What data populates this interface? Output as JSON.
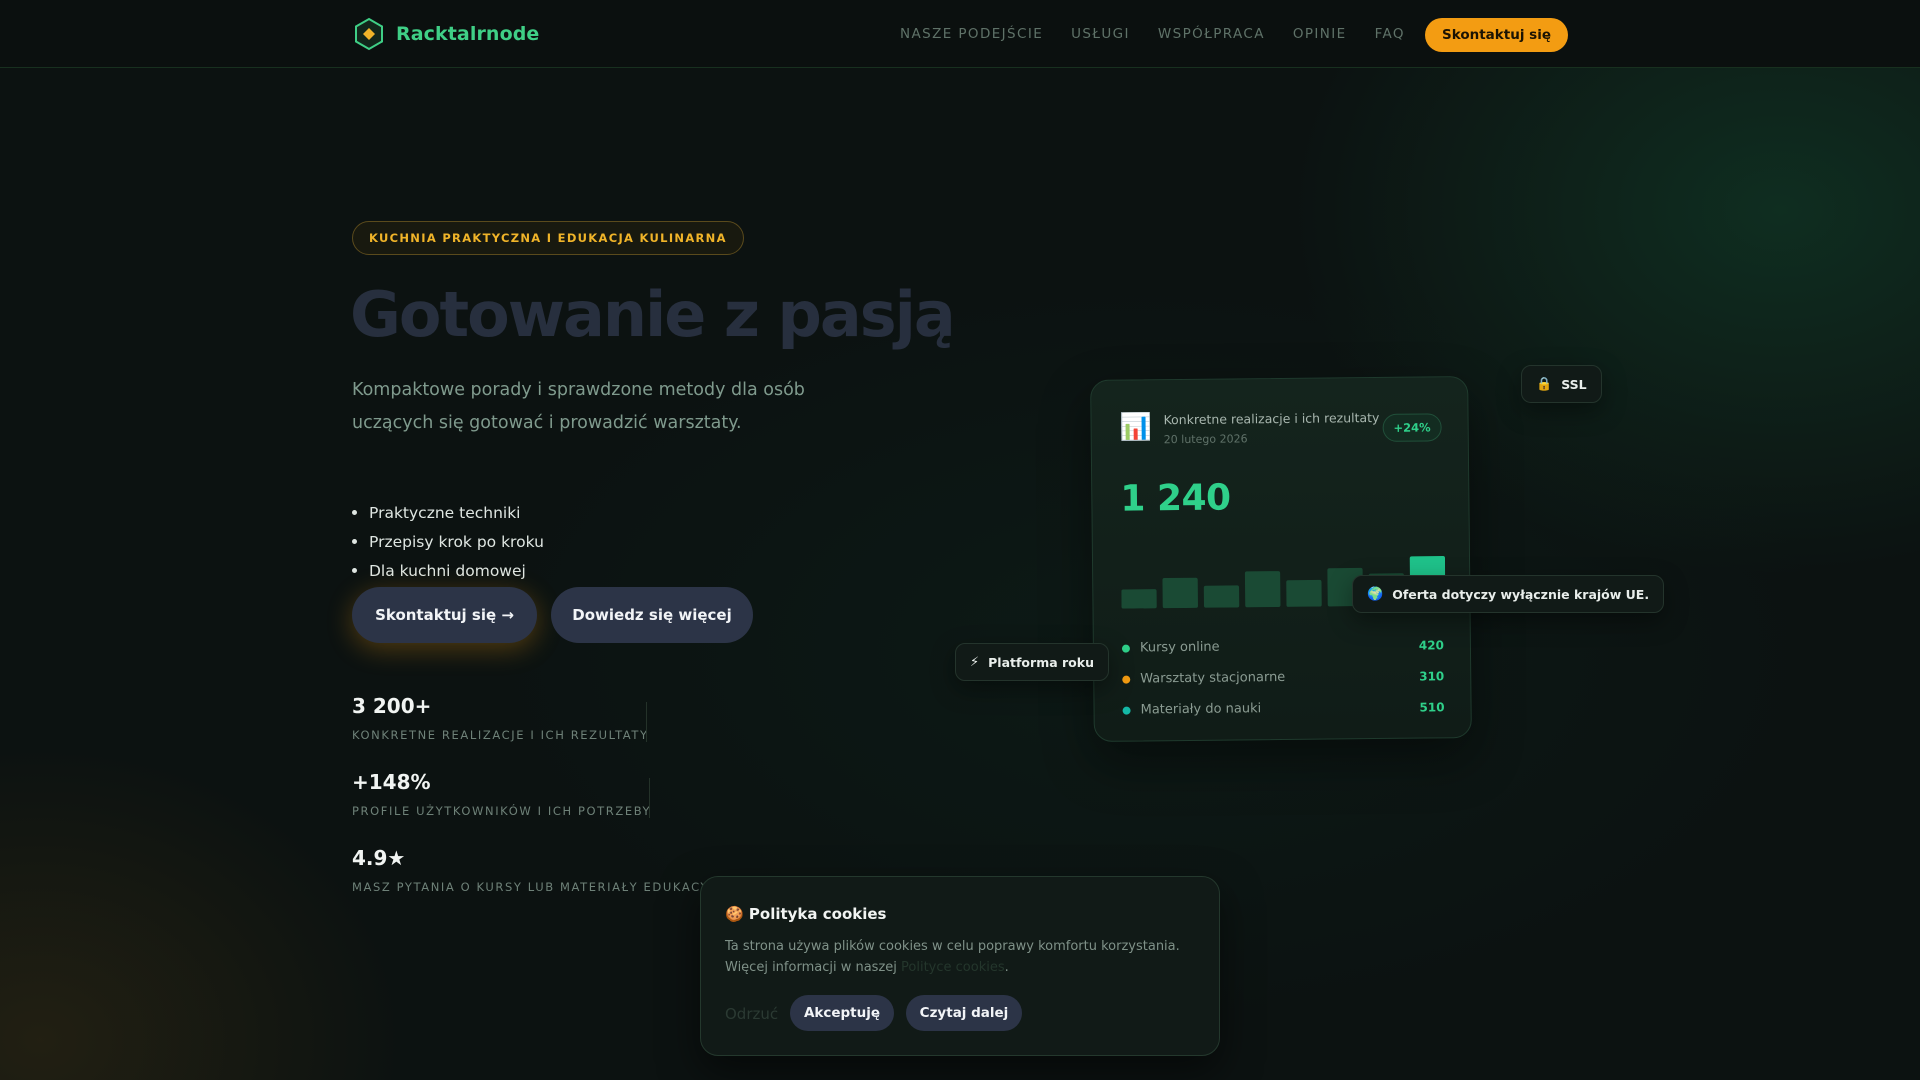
{
  "brand": {
    "name": "Racktalrnode",
    "accent": "#3fcf86",
    "cta_color": "#f39c12",
    "icon": "hexagon-logo-icon"
  },
  "nav": {
    "links": [
      "NASZE PODEJŚCIE",
      "USŁUGI",
      "WSPÓŁPRACA",
      "OPINIE",
      "FAQ"
    ],
    "cta": "Skontaktuj się"
  },
  "hero": {
    "badge": "KUCHNIA PRAKTYCZNA I EDUKACJA KULINARNA",
    "title": "Gotowanie z pasją",
    "subtitle": "Kompaktowe porady i sprawdzone metody dla osób uczących się gotować i prowadzić warsztaty.",
    "list": [
      "Praktyczne techniki",
      "Przepisy krok po kroku",
      "Dla kuchni domowej"
    ],
    "primary_button": "Skontaktuj się →",
    "secondary_button": "Dowiedz się więcej"
  },
  "stats": [
    {
      "value": "3 200+",
      "label": "KONKRETNE REALIZACJE I ICH REZULTATY"
    },
    {
      "value": "+148%",
      "label": "PROFILE UŻYTKOWNIKÓW I ICH POTRZEBY"
    },
    {
      "value": "4.9★",
      "label": "MASZ PYTANIA O KURSY LUB MATERIAŁY EDUKACYJNE"
    }
  ],
  "dashboard": {
    "icon": "bar-chart-icon",
    "title": "Konkretne realizacje i ich rezultaty",
    "date": "20 lutego 2026",
    "badge": "+24%",
    "big_number": "1 240",
    "bars": [
      0.33,
      0.52,
      0.38,
      0.62,
      0.46,
      0.66,
      0.56,
      0.85
    ],
    "bar_color": "#1a4a34",
    "bar_highlight_color": "#1fc28a",
    "legend": [
      {
        "label": "Kursy online",
        "value": "420",
        "color": "#2fd08a"
      },
      {
        "label": "Warsztaty stacjonarne",
        "value": "310",
        "color": "#f39c12"
      },
      {
        "label": "Materiały do nauki",
        "value": "510",
        "color": "#14b8a6"
      }
    ]
  },
  "chips": {
    "ssl": {
      "icon": "lock-icon",
      "glyph": "🔒",
      "label": "SSL"
    },
    "eu": {
      "icon": "globe-icon",
      "glyph": "🌍",
      "label": "Oferta dotyczy wyłącznie krajów UE."
    },
    "platform": {
      "icon": "lightning-icon",
      "glyph": "⚡",
      "label": "Platforma roku"
    }
  },
  "cookie": {
    "title": "🍪 Polityka cookies",
    "text": "Ta strona używa plików cookies w celu poprawy komfortu korzystania. Więcej informacji w naszej",
    "link": "Polityce cookies",
    "text_end": ".",
    "reject": "Odrzuć",
    "accept": "Akceptuję",
    "more": "Czytaj dalej"
  }
}
